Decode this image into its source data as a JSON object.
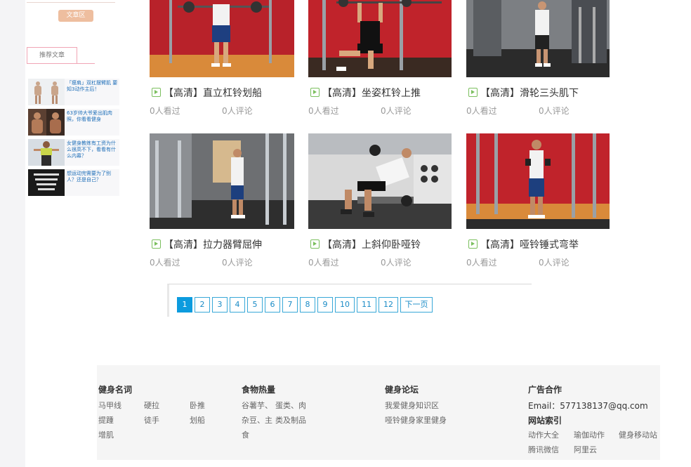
{
  "sidebar": {
    "article_zone_button": "文章区",
    "recommend_tab": "推荐文章",
    "recommend_items": [
      {
        "text": "「瘦肩」双杠摆臂肌 要知3动作主后！"
      },
      {
        "text": "63岁帅大爷爱出肌肉照，你看看健身"
      },
      {
        "text": "女健身教练有工资为什么很高不下，看看有什么内幕？"
      },
      {
        "text": "想运动完需要为了别人？还是自己？"
      }
    ]
  },
  "videos": [
    {
      "title": "【高清】直立杠铃划船",
      "views": "0人看过",
      "comments": "0人评论"
    },
    {
      "title": "【高清】坐姿杠铃上推",
      "views": "0人看过",
      "comments": "0人评论"
    },
    {
      "title": "【高清】滑轮三头肌下",
      "views": "0人看过",
      "comments": "0人评论"
    },
    {
      "title": "【高清】拉力器臂屈伸",
      "views": "0人看过",
      "comments": "0人评论"
    },
    {
      "title": "【高清】上斜仰卧哑铃",
      "views": "0人看过",
      "comments": "0人评论"
    },
    {
      "title": "【高清】哑铃锤式弯举",
      "views": "0人看过",
      "comments": "0人评论"
    }
  ],
  "pagination": {
    "pages": [
      "1",
      "2",
      "3",
      "4",
      "5",
      "6",
      "7",
      "8",
      "9",
      "10",
      "11",
      "12"
    ],
    "current": "1",
    "next_label": "下一页"
  },
  "footer": {
    "fitness_terms": {
      "heading": "健身名词",
      "links": [
        "马甲线",
        "硬拉",
        "卧推",
        "提踵",
        "徒手",
        "划船",
        "增肌"
      ]
    },
    "food_calories": {
      "heading": "食物热量",
      "links": [
        "谷薯芋、",
        "蛋类、肉",
        "杂豆、主",
        "类及制品",
        "食"
      ]
    },
    "forum": {
      "heading": "健身论坛",
      "links": [
        "我爱健身知识区",
        "哑铃健身家里健身"
      ]
    },
    "ads": {
      "heading": "广告合作",
      "email": "Email：577138137@qq.com"
    },
    "site_index": {
      "heading": "网站索引",
      "links": [
        "动作大全",
        "瑜伽动作",
        "健身移动站",
        "腾讯微信",
        "阿里云"
      ]
    }
  },
  "colors": {
    "accent_blue": "#0c9bde",
    "play_icon_green": "#7bbf5e",
    "article_button": "#eebe9f",
    "gym_red": "#c8262c"
  }
}
